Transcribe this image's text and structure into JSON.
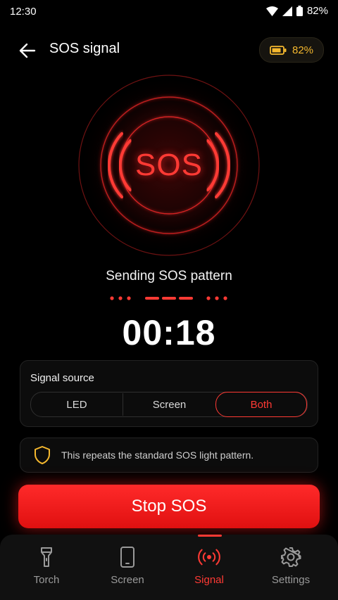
{
  "status_bar": {
    "time": "12:30",
    "battery": "82%"
  },
  "header": {
    "title": "SOS signal",
    "battery_chip": "82%"
  },
  "sos": {
    "label": "SOS",
    "status_text": "Sending SOS pattern",
    "timer": "00:18"
  },
  "signal_source": {
    "label": "Signal source",
    "options": [
      "LED",
      "Screen",
      "Both"
    ],
    "selected": "Both"
  },
  "note": {
    "text": "This repeats the standard SOS light pattern."
  },
  "stop_button": {
    "label": "Stop SOS"
  },
  "nav": {
    "items": [
      {
        "label": "Torch",
        "icon": "torch-icon"
      },
      {
        "label": "Screen",
        "icon": "phone-icon"
      },
      {
        "label": "Signal",
        "icon": "signal-icon"
      },
      {
        "label": "Settings",
        "icon": "gear-icon"
      }
    ],
    "selected": "Signal"
  },
  "colors": {
    "accent": "#ff3a34",
    "battery": "#f5b82e",
    "background": "#000000"
  }
}
